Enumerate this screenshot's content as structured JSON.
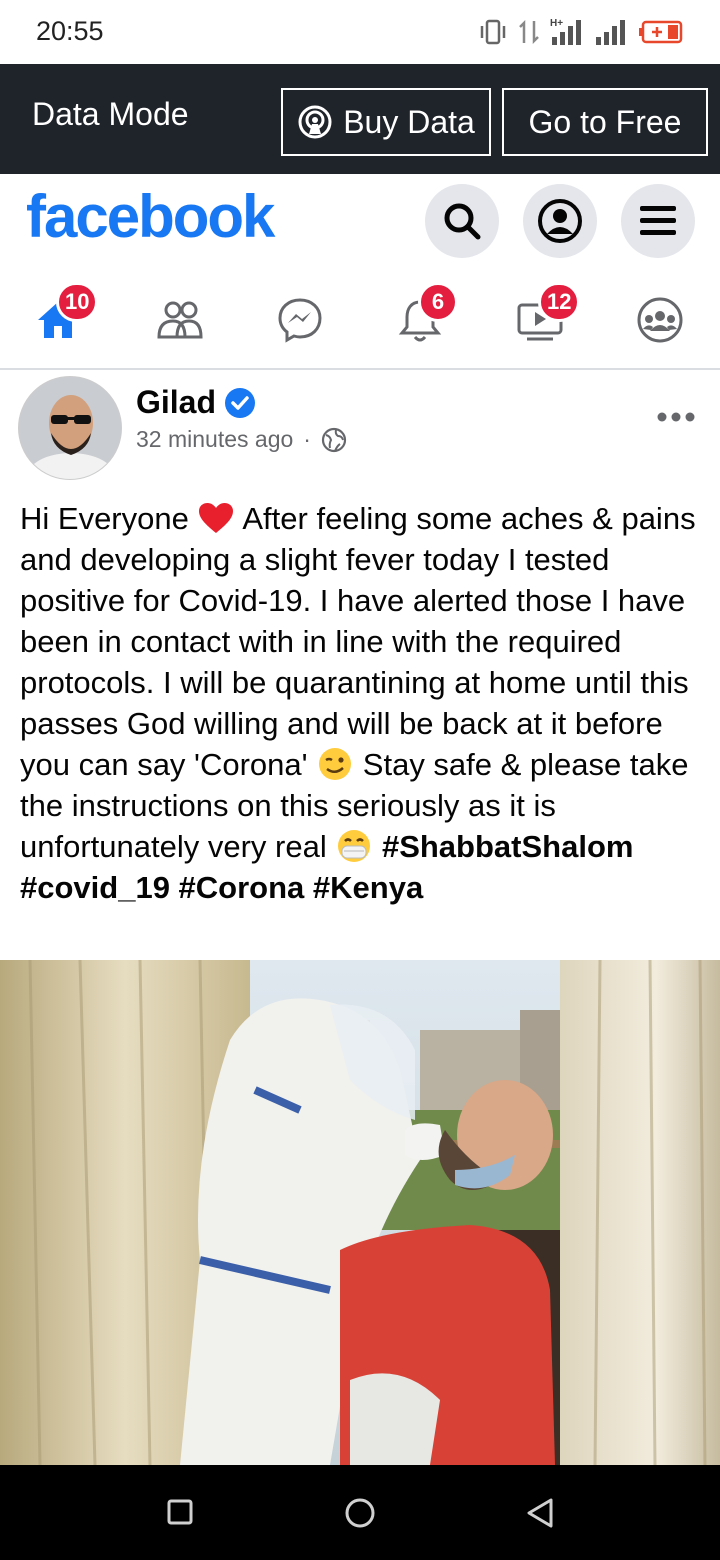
{
  "status_bar": {
    "time": "20:55"
  },
  "data_bar": {
    "label": "Data Mode",
    "buy_button": "Buy Data",
    "free_button": "Go to Free"
  },
  "header": {
    "logo": "facebook"
  },
  "nav": {
    "home_badge": "10",
    "notifications_badge": "6",
    "watch_badge": "12"
  },
  "post": {
    "author": "Gilad",
    "timestamp": "32 minutes ago",
    "text_1": "Hi Everyone ",
    "text_2": " After feeling some aches & pains and developing a slight fever today I tested positive for Covid-19. I have alerted those I have been in contact with in line with the required protocols. I will be quarantining at home until this passes God willing and will be back at it before you can say 'Corona' ",
    "text_3": " Stay safe & please take the instructions on this seriously as it is unfortunately very real ",
    "hashtags": "#ShabbatShalom #covid_19 #Corona #Kenya"
  },
  "colors": {
    "brand": "#1877f2",
    "badge": "#e41e3f",
    "data_bar": "#1f232a"
  }
}
